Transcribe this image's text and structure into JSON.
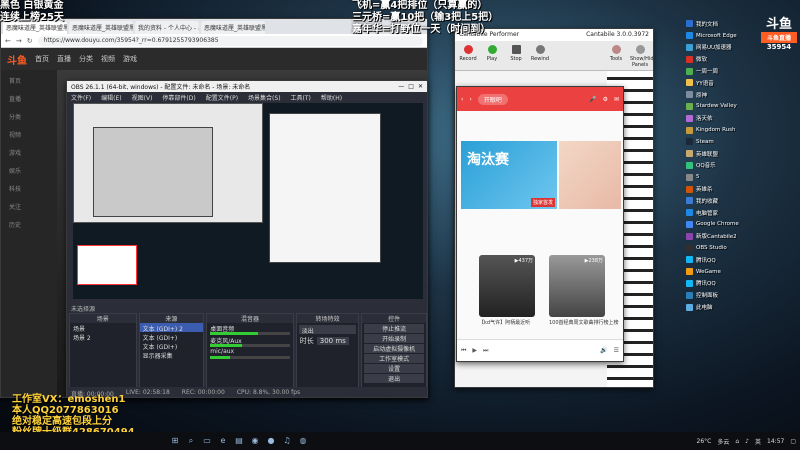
{
  "overlay": {
    "top_left_1": "黑色 白银黄金",
    "top_left_2": "连续上榜25天",
    "top_center_1": "飞机=赢4把排位（只算赢的）",
    "top_center_2": "三元桥=赢10把（输3把上5把）",
    "top_center_3": "嘉年华=打野位一天（时间到）",
    "studio_vx": "工作室VX：emoshen1",
    "personal_qq": "本人QQ2077863016",
    "guarantee": "绝对稳定高速包段上分",
    "fan_group": "粉丝牌十级群428670494"
  },
  "browser": {
    "tabs": [
      "恶魔味道厘_英雄联盟黑_斗鱼",
      "恶魔味道厘_英雄联盟黑_斗鱼",
      "我的资料 - 个人中心 - 斗鱼",
      "恶魔味道厘_英雄联盟黑_斗鱼"
    ],
    "url": "https://www.douyu.com/35954?_rr=0.6791255793906385",
    "site_logo": "斗鱼",
    "nav": [
      "首页",
      "直播",
      "分类",
      "视频",
      "游戏"
    ],
    "left_menu": [
      "首页",
      "直播",
      "分类",
      "视频",
      "游戏",
      "娱乐",
      "科技",
      "关注",
      "历史"
    ]
  },
  "obs": {
    "title": "OBS 26.1.1 (64-bit, windows) - 配置文件: 未命名 - 场景: 未命名",
    "menu": [
      "文件(F)",
      "编辑(E)",
      "视图(V)",
      "停靠部件(D)",
      "配置文件(P)",
      "场景集合(S)",
      "工具(T)",
      "帮助(H)"
    ],
    "subbar": "未选择源",
    "docks": {
      "scenes": {
        "title": "场景",
        "items": [
          "场景",
          "场景 2"
        ]
      },
      "sources": {
        "title": "来源",
        "items": [
          "文本 (GDI+) 2",
          "文本 (GDI+)",
          "文本 (GDI+)",
          "显示器采集"
        ]
      },
      "mixer": {
        "title": "混音器",
        "items": [
          "桌面音频",
          "麦克风/Aux",
          "mic/aux"
        ]
      },
      "transitions": {
        "title": "转场特效",
        "fade": "淡出",
        "duration_label": "时长",
        "duration": "300 ms"
      },
      "controls": {
        "title": "控件",
        "buttons": [
          "停止推流",
          "开始录制",
          "启动虚拟摄像机",
          "工作室模式",
          "设置",
          "退出"
        ]
      }
    },
    "status": [
      "直播: 00:00:00",
      "LIVE: 02:58:18",
      "REC: 00:00:00",
      "CPU: 8.8%, 30.00 fps"
    ]
  },
  "cantabile": {
    "title": "Cantabile Performer",
    "version": "Cantabile 3.0.0.3972",
    "toolbar": [
      "Record",
      "Play",
      "Stop",
      "Rewind",
      "Tools",
      "Show/Hide Panels"
    ]
  },
  "music": {
    "search_placeholder": "开眼吧",
    "banner_title": "淘汰赛",
    "banner_tag": "独家首发",
    "card1_count": "▶437万",
    "card1_title": "【kd气许】阿柄最近听",
    "card2_count": "▶238万",
    "card2_title": "100首经典周文歌曲排行榜上榜"
  },
  "desktop": {
    "corner_logo": "斗鱼",
    "corner_sub": "斗鱼直播",
    "room_id": "35954",
    "icons": [
      "我的文档",
      "Microsoft Edge",
      "网易UU加速器",
      "微软",
      "一周一周",
      "YY语音",
      "原神",
      "Stardew Valley",
      "洛天依",
      "Kingdom Rush",
      "Steam",
      "英雄联盟",
      "QQ音乐",
      "5",
      "英雄杀",
      "我的收藏",
      "电脑管家",
      "Google Chrome",
      "新版Cantabile2",
      "OBS Studio",
      "腾讯QQ",
      "WeGame",
      "腾讯QQ",
      "控制面板",
      "此电脑"
    ],
    "icon_colors": [
      "#2a6ed1",
      "#1e88e5",
      "#3aa0d6",
      "#d93025",
      "#4caf50",
      "#f0c04a",
      "#7e8ca0",
      "#6ab04c",
      "#b36ad6",
      "#c79a3a",
      "#1b2838",
      "#c8aa6e",
      "#31c27c",
      "#888888",
      "#d35400",
      "#3a7bd5",
      "#1e88e5",
      "#4285f4",
      "#8e44ad",
      "#302e31",
      "#12b7f5",
      "#f39c12",
      "#12b7f5",
      "#2980b9",
      "#5dade2"
    ],
    "taskbar": {
      "temp": "26°C",
      "weather": "多云",
      "time": "14:57",
      "ime": "英"
    }
  }
}
